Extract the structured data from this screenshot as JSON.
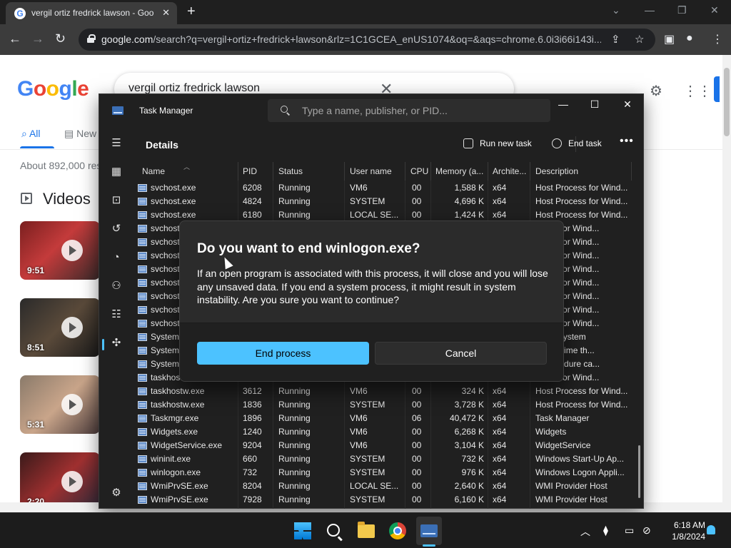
{
  "browser": {
    "tab": {
      "title": "vergil ortiz fredrick lawson - Goo",
      "favicon": "google-g-icon"
    },
    "url": {
      "host": "google.com",
      "path": "/search?q=vergil+ortiz+fredrick+lawson&rlz=1C1GCEA_enUS1074&oq=&aqs=chrome.6.0i3i66i143i..."
    }
  },
  "google": {
    "query": "vergil ortiz fredrick lawson",
    "tabs": [
      "All",
      "New"
    ],
    "stats": "About 892,000 res",
    "videos_heading": "Videos",
    "videos": [
      {
        "duration": "9:51"
      },
      {
        "duration": "8:51"
      },
      {
        "duration": "5:31"
      },
      {
        "duration": "2:20"
      }
    ]
  },
  "taskmanager": {
    "title": "Task Manager",
    "search_placeholder": "Type a name, publisher, or PID...",
    "page_title": "Details",
    "commands": {
      "run_new_task": "Run new task",
      "end_task": "End task"
    },
    "columns": [
      "Name",
      "PID",
      "Status",
      "User name",
      "CPU",
      "Memory (a...",
      "Archite...",
      "Description"
    ],
    "rows": [
      {
        "name": "svchost.exe",
        "pid": "6208",
        "status": "Running",
        "user": "VM6",
        "cpu": "00",
        "mem": "1,588 K",
        "arch": "x64",
        "desc": "Host Process for Wind..."
      },
      {
        "name": "svchost.exe",
        "pid": "4824",
        "status": "Running",
        "user": "SYSTEM",
        "cpu": "00",
        "mem": "4,696 K",
        "arch": "x64",
        "desc": "Host Process for Wind..."
      },
      {
        "name": "svchost.exe",
        "pid": "6180",
        "status": "Running",
        "user": "LOCAL SE...",
        "cpu": "00",
        "mem": "1,424 K",
        "arch": "x64",
        "desc": "Host Process for Wind..."
      },
      {
        "name": "svchost",
        "pid": "",
        "status": "",
        "user": "",
        "cpu": "",
        "mem": "",
        "arch": "",
        "desc": "ocess for Wind..."
      },
      {
        "name": "svchost",
        "pid": "",
        "status": "",
        "user": "",
        "cpu": "",
        "mem": "",
        "arch": "",
        "desc": "ocess for Wind..."
      },
      {
        "name": "svchost",
        "pid": "",
        "status": "",
        "user": "",
        "cpu": "",
        "mem": "",
        "arch": "",
        "desc": "ocess for Wind..."
      },
      {
        "name": "svchost",
        "pid": "",
        "status": "",
        "user": "",
        "cpu": "",
        "mem": "",
        "arch": "",
        "desc": "ocess for Wind..."
      },
      {
        "name": "svchost",
        "pid": "",
        "status": "",
        "user": "",
        "cpu": "",
        "mem": "",
        "arch": "",
        "desc": "ocess for Wind..."
      },
      {
        "name": "svchost",
        "pid": "",
        "status": "",
        "user": "",
        "cpu": "",
        "mem": "",
        "arch": "",
        "desc": "ocess for Wind..."
      },
      {
        "name": "svchost",
        "pid": "",
        "status": "",
        "user": "",
        "cpu": "",
        "mem": "",
        "arch": "",
        "desc": "ocess for Wind..."
      },
      {
        "name": "svchost",
        "pid": "",
        "status": "",
        "user": "",
        "cpu": "",
        "mem": "",
        "arch": "",
        "desc": "ocess for Wind..."
      },
      {
        "name": "System",
        "pid": "",
        "status": "",
        "user": "",
        "cpu": "",
        "mem": "",
        "arch": "",
        "desc": "nel & System"
      },
      {
        "name": "System",
        "pid": "",
        "status": "",
        "user": "",
        "cpu": "",
        "mem": "",
        "arch": "",
        "desc": "age of time th..."
      },
      {
        "name": "System",
        "pid": "",
        "status": "",
        "user": "",
        "cpu": "",
        "mem": "",
        "arch": "",
        "desc": "d procedure ca..."
      },
      {
        "name": "taskhost",
        "pid": "",
        "status": "",
        "user": "",
        "cpu": "",
        "mem": "",
        "arch": "",
        "desc": "ocess for Wind..."
      },
      {
        "name": "taskhostw.exe",
        "pid": "3612",
        "status": "Running",
        "user": "VM6",
        "cpu": "00",
        "mem": "324 K",
        "arch": "x64",
        "desc": "Host Process for Wind..."
      },
      {
        "name": "taskhostw.exe",
        "pid": "1836",
        "status": "Running",
        "user": "SYSTEM",
        "cpu": "00",
        "mem": "3,728 K",
        "arch": "x64",
        "desc": "Host Process for Wind..."
      },
      {
        "name": "Taskmgr.exe",
        "pid": "1896",
        "status": "Running",
        "user": "VM6",
        "cpu": "06",
        "mem": "40,472 K",
        "arch": "x64",
        "desc": "Task Manager"
      },
      {
        "name": "Widgets.exe",
        "pid": "1240",
        "status": "Running",
        "user": "VM6",
        "cpu": "00",
        "mem": "6,268 K",
        "arch": "x64",
        "desc": "Widgets"
      },
      {
        "name": "WidgetService.exe",
        "pid": "9204",
        "status": "Running",
        "user": "VM6",
        "cpu": "00",
        "mem": "3,104 K",
        "arch": "x64",
        "desc": "WidgetService"
      },
      {
        "name": "wininit.exe",
        "pid": "660",
        "status": "Running",
        "user": "SYSTEM",
        "cpu": "00",
        "mem": "732 K",
        "arch": "x64",
        "desc": "Windows Start-Up Ap..."
      },
      {
        "name": "winlogon.exe",
        "pid": "732",
        "status": "Running",
        "user": "SYSTEM",
        "cpu": "00",
        "mem": "976 K",
        "arch": "x64",
        "desc": "Windows Logon Appli..."
      },
      {
        "name": "WmiPrvSE.exe",
        "pid": "8204",
        "status": "Running",
        "user": "LOCAL SE...",
        "cpu": "00",
        "mem": "2,640 K",
        "arch": "x64",
        "desc": "WMI Provider Host"
      },
      {
        "name": "WmiPrvSE.exe",
        "pid": "7928",
        "status": "Running",
        "user": "SYSTEM",
        "cpu": "00",
        "mem": "6,160 K",
        "arch": "x64",
        "desc": "WMI Provider Host"
      }
    ]
  },
  "dialog": {
    "title": "Do you want to end winlogon.exe?",
    "body": "If an open program is associated with this process, it will close and you will lose any unsaved data. If you end a system process, it might result in system instability. Are you sure you want to continue?",
    "primary": "End process",
    "secondary": "Cancel"
  },
  "taskbar": {
    "time": "6:18 AM",
    "date": "1/8/2024"
  },
  "colors": {
    "accent": "#4cc2ff",
    "tm_bg": "#202020",
    "dialog_bg": "#2b2b2b",
    "google_blue": "#1a73e8"
  }
}
